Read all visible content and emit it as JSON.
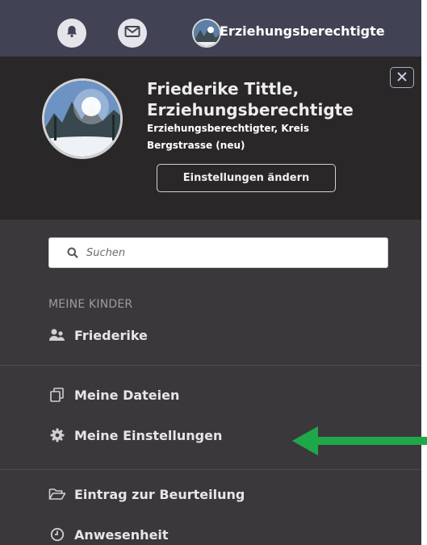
{
  "topbar": {
    "icons": [
      "bell-icon",
      "mail-icon"
    ],
    "role_label": "Erziehungsberechtigte"
  },
  "profile": {
    "name_line1": "Friederike Tittle,",
    "name_line2": "Erziehungsberechtigte",
    "role_line1": "Erziehungsberechtigter, Kreis",
    "role_line2": "Bergstrasse (neu)",
    "settings_button": "Einstellungen ändern"
  },
  "search": {
    "placeholder": "Suchen"
  },
  "children_section": {
    "heading": "MEINE KINDER",
    "child_name": "Friederike"
  },
  "menu": {
    "files": "Meine Dateien",
    "settings": "Meine Einstellungen",
    "assessment": "Eintrag zur Beurteilung",
    "attendance": "Anwesenheit"
  },
  "colors": {
    "panel": "#3b383c",
    "profile_bg": "#2a2729",
    "topbar": "#424255",
    "arrow": "#1fa84a"
  }
}
